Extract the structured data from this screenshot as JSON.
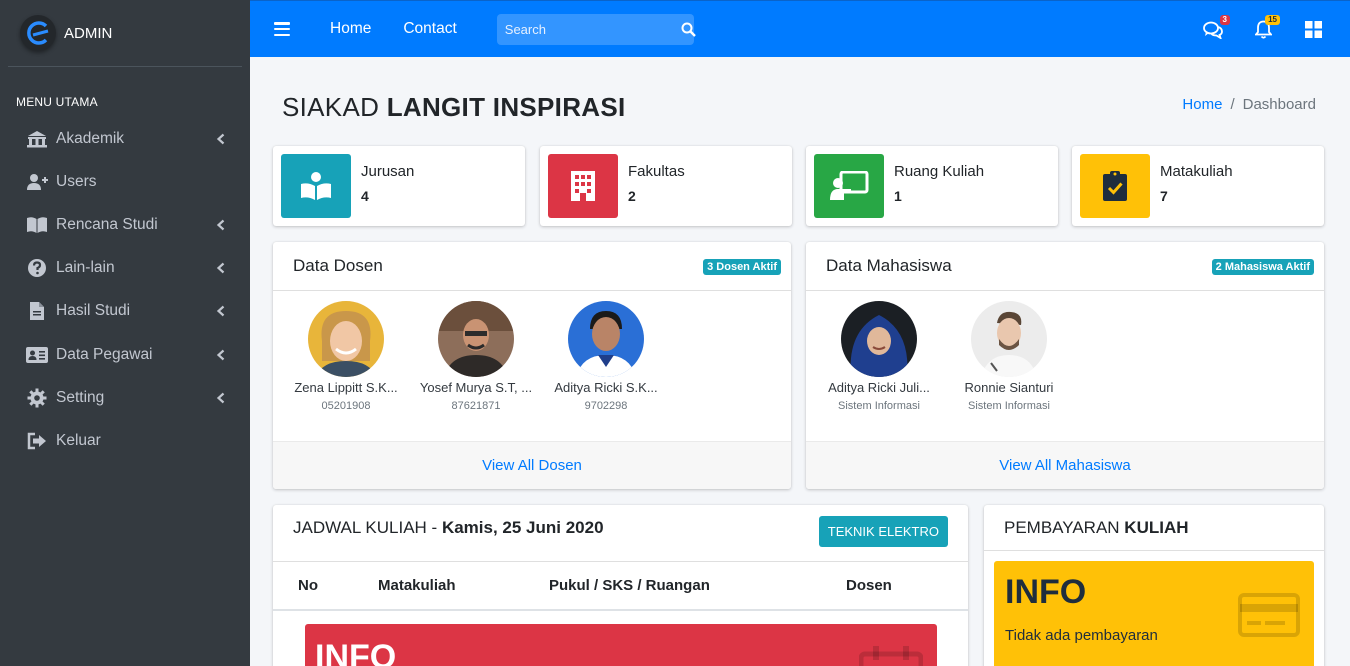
{
  "colors": {
    "sidebar": "#343a40",
    "navbar": "#007bff",
    "info": "#17a2b8",
    "danger": "#dc3545",
    "success": "#28a745",
    "warning": "#ffc107"
  },
  "brand": {
    "name": "ADMIN",
    "logo_icon": "brand-logo-icon"
  },
  "sidebar": {
    "header": "MENU UTAMA",
    "items": [
      {
        "label": "Akademik",
        "icon": "university-icon",
        "chevron": true
      },
      {
        "label": "Users",
        "icon": "user-plus-icon",
        "chevron": false
      },
      {
        "label": "Rencana Studi",
        "icon": "book-icon",
        "chevron": true
      },
      {
        "label": "Lain-lain",
        "icon": "question-circle-icon",
        "chevron": true
      },
      {
        "label": "Hasil Studi",
        "icon": "file-icon",
        "chevron": true
      },
      {
        "label": "Data Pegawai",
        "icon": "id-card-icon",
        "chevron": true
      },
      {
        "label": "Setting",
        "icon": "gear-icon",
        "chevron": true
      },
      {
        "label": "Keluar",
        "icon": "sign-out-icon",
        "chevron": false
      }
    ]
  },
  "navbar": {
    "home": "Home",
    "contact": "Contact",
    "search_placeholder": "Search",
    "messages_count": "3",
    "notifications_count": "15"
  },
  "page": {
    "title_light": "SIAKAD ",
    "title_bold": "LANGIT INSPIRASI",
    "breadcrumb": {
      "home": "Home",
      "sep": "/",
      "current": "Dashboard"
    }
  },
  "stats": [
    {
      "label": "Jurusan",
      "value": "4",
      "icon": "book-reader-icon",
      "color": "#17a2b8"
    },
    {
      "label": "Fakultas",
      "value": "2",
      "icon": "building-icon",
      "color": "#dc3545"
    },
    {
      "label": "Ruang Kuliah",
      "value": "1",
      "icon": "chalkboard-teacher-icon",
      "color": "#28a745"
    },
    {
      "label": "Matakuliah",
      "value": "7",
      "icon": "clipboard-check-icon",
      "color": "#ffc107"
    }
  ],
  "dosen": {
    "title": "Data Dosen",
    "badge": "3 Dosen Aktif",
    "people": [
      {
        "name": "Zena Lippitt S.K...",
        "sub": "05201908"
      },
      {
        "name": "Yosef Murya S.T, ...",
        "sub": "87621871"
      },
      {
        "name": "Aditya Ricki S.K...",
        "sub": "9702298"
      }
    ],
    "footer": "View All Dosen"
  },
  "mahasiswa": {
    "title": "Data Mahasiswa",
    "badge": "2 Mahasiswa Aktif",
    "people": [
      {
        "name": "Aditya Ricki Juli...",
        "sub": "Sistem Informasi"
      },
      {
        "name": "Ronnie Sianturi",
        "sub": "Sistem Informasi"
      }
    ],
    "footer": "View All Mahasiswa"
  },
  "jadwal": {
    "title_light": "JADWAL KULIAH - ",
    "title_bold": "Kamis, 25 Juni 2020",
    "button": "TEKNIK ELEKTRO",
    "columns": [
      "No",
      "Matakuliah",
      "Pukul / SKS / Ruangan",
      "Dosen"
    ],
    "alert": "INFO"
  },
  "pembayaran": {
    "title_light": "PEMBAYARAN ",
    "title_bold": "KULIAH",
    "info": "INFO",
    "message": "Tidak ada pembayaran"
  }
}
